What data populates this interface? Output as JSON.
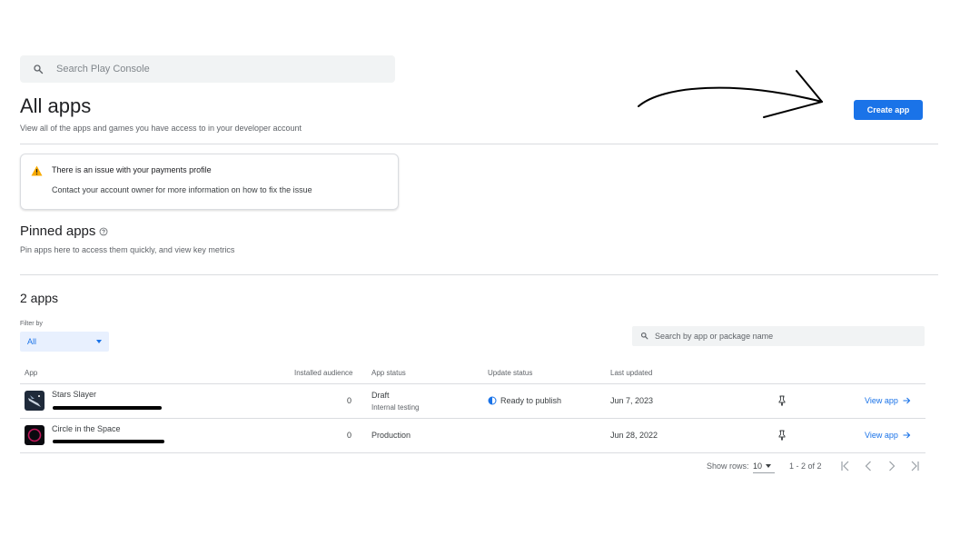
{
  "search": {
    "placeholder": "Search Play Console",
    "icon": "search-icon"
  },
  "header": {
    "title": "All apps",
    "subtitle": "View all of the apps and games you have access to in your developer account",
    "create_button": "Create app"
  },
  "alert": {
    "icon": "warning-icon",
    "title": "There is an issue with your payments profile",
    "body": "Contact your account owner for more information on how to fix the issue"
  },
  "pinned": {
    "title": "Pinned apps",
    "subtitle": "Pin apps here to access them quickly, and view key metrics"
  },
  "apps": {
    "count_title": "2 apps",
    "filter_label": "Filter by",
    "filter_value": "All",
    "search_placeholder": "Search by app or package name",
    "columns": {
      "app": "App",
      "installed_audience": "Installed audience",
      "app_status": "App status",
      "update_status": "Update status",
      "last_updated": "Last updated"
    },
    "rows": [
      {
        "name": "Stars Slayer",
        "installed": "0",
        "status": "Draft",
        "status_sub": "Internal testing",
        "update_status": "Ready to publish",
        "last_updated": "Jun 7, 2023",
        "action": "View app"
      },
      {
        "name": "Circle in the Space",
        "installed": "0",
        "status": "Production",
        "status_sub": "",
        "update_status": "",
        "last_updated": "Jun 28, 2022",
        "action": "View app"
      }
    ],
    "pagination": {
      "rows_label": "Show rows:",
      "rows_value": "10",
      "range": "1 - 2 of 2"
    }
  },
  "colors": {
    "accent": "#1a73e8",
    "warning": "#f9ab00"
  }
}
